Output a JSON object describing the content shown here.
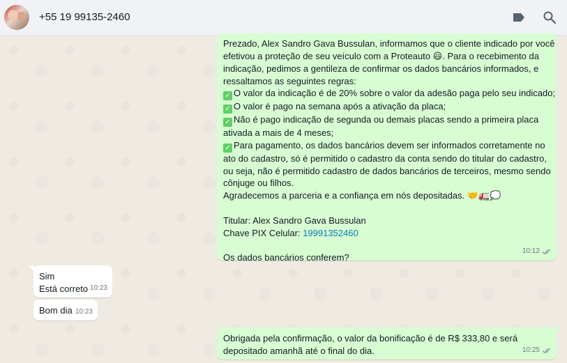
{
  "header": {
    "contact_name": "+55 19 99135-2460"
  },
  "messages": {
    "m1": {
      "lines": [
        "Prezado, Alex Sandro Gava Bussulan, informamos que o cliente indicado por você",
        "efetivou a proteção de seu veículo com a Proteauto",
        ". Para o recebimento da",
        "indicação, pedimos a gentileza de confirmar os dados bancários informados, e",
        "ressaltamos as seguintes regras:",
        "O valor da indicação é de 20% sobre o valor da adesão paga pelo seu indicado;",
        "O valor é pago na semana após a ativação da placa;",
        "Não é pago indicação de segunda ou demais placas sendo a primeira placa",
        "ativada a mais de 4 meses;",
        "Para pagamento, os dados bancários devem ser informados corretamente no",
        "ato do cadastro, só é permitido o cadastro da conta sendo do titular do cadastro,",
        "ou seja, não é permitido cadastro de dados bancários de terceiros, mesmo sendo",
        "cônjuge ou filhos.",
        "Agradecemos a parceria e a confiança em nós depositadas."
      ],
      "titular": "Titular: Alex Sandro Gava Bussulan",
      "pix_label": "Chave PIX Celular: ",
      "pix_value": "19991352460",
      "question": "Os dados bancários conferem?",
      "time": "10:12",
      "check_glyph": "✓",
      "smile_emoji": "😃",
      "end_emojis": "🤝🚛💭"
    },
    "m2": {
      "line1": "Sim",
      "line2": "Está correto",
      "time": "10:23"
    },
    "m3": {
      "text": "Bom dia",
      "time": "10:23"
    },
    "m4": {
      "line1": "Obrigada pela confirmação, o valor da bonificação é de R$ 333,80 e será",
      "line2": "depositado amanhã até o final do dia.",
      "time": "10:25"
    }
  },
  "icons": {
    "label": "label-icon",
    "search": "search-icon",
    "read_receipt": "double-check-icon"
  },
  "colors": {
    "outgoing_bubble": "#d9fdd3",
    "incoming_bubble": "#ffffff",
    "link": "#027eb5",
    "chat_background": "#efeae2",
    "header_background": "#f0f2f5"
  }
}
